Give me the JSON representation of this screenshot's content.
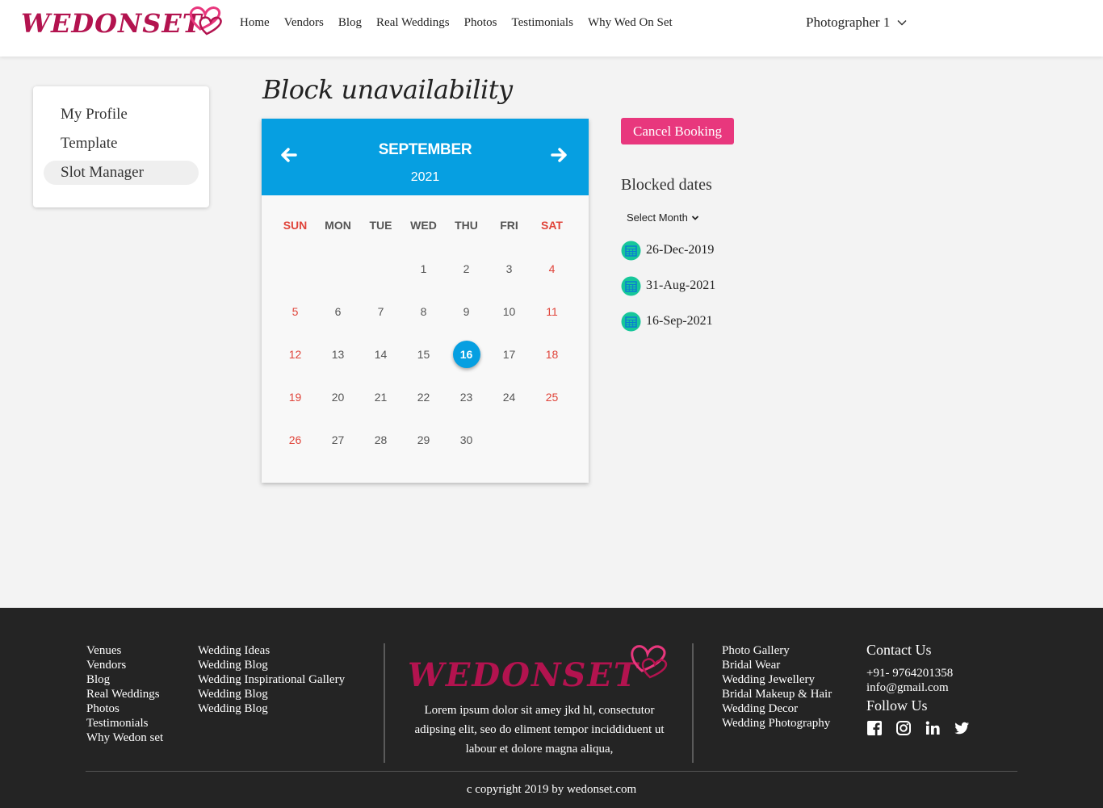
{
  "brand": {
    "name": "WEDONSET",
    "color": "#b3134f",
    "accent": "#e8377d",
    "calendar_blue": "#069fe1"
  },
  "nav": {
    "items": [
      "Home",
      "Vendors",
      "Blog",
      "Real Weddings",
      "Photos",
      "Testimonials",
      "Why Wed On Set"
    ]
  },
  "user": {
    "name": "Photographer 1"
  },
  "sidebar": {
    "items": [
      {
        "label": "My Profile"
      },
      {
        "label": "Template"
      },
      {
        "label": "Slot Manager",
        "active": true
      }
    ]
  },
  "page": {
    "title": "Block unavailability"
  },
  "calendar": {
    "month": "SEPTEMBER",
    "year": "2021",
    "weekdays": [
      "SUN",
      "MON",
      "TUE",
      "WED",
      "THU",
      "FRI",
      "SAT"
    ],
    "first_weekday_index": 3,
    "days_in_month": 30,
    "selected_day": 16
  },
  "actions": {
    "cancel_booking": "Cancel Booking"
  },
  "blocked": {
    "title": "Blocked dates",
    "select_label": "Select Month",
    "dates": [
      "26-Dec-2019",
      "31-Aug-2021",
      "16-Sep-2021"
    ]
  },
  "footer": {
    "col1": [
      "Venues",
      "Vendors",
      "Blog",
      "Real Weddings",
      "Photos",
      "Testimonials",
      "Why Wedon set"
    ],
    "col2": [
      "Wedding Ideas",
      "Wedding Blog",
      "Wedding Inspirational Gallery",
      "Wedding Blog",
      "Wedding Blog"
    ],
    "about": "Lorem ipsum dolor sit amey jkd hl, consectutor adipsing elit, seo do eliment tempor inciddiduent ut labour et dolore magna aliqua,",
    "col3": [
      "Photo Gallery",
      "Bridal Wear",
      "Wedding Jewellery",
      "Bridal Makeup & Hair",
      "Wedding Decor",
      "Wedding Photography"
    ],
    "contact_title": "Contact Us",
    "phone": "+91- 9764201358",
    "email": "info@gmail.com",
    "follow_title": "Follow Us",
    "socials": [
      "facebook-icon",
      "instagram-icon",
      "linkedin-icon",
      "twitter-icon"
    ],
    "copyright": "c copyright 2019 by wedonset.com"
  }
}
